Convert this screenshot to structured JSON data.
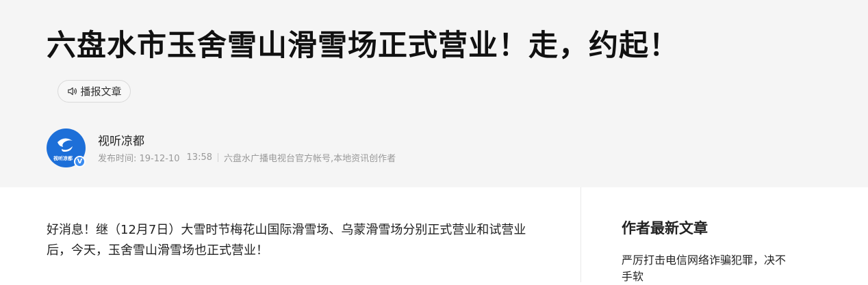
{
  "article": {
    "title": "六盘水市玉舍雪山滑雪场正式营业！走，约起！",
    "listen_label": "播报文章",
    "content": "好消息！继（12月7日）大雪时节梅花山国际滑雪场、乌蒙滑雪场分别正式营业和试营业后，今天，玉舍雪山滑雪场也正式营业！"
  },
  "author": {
    "name": "视听凉都",
    "avatar_text": "视听凉都",
    "verified_mark": "V",
    "publish_date": "发布时间: 19-12-10",
    "publish_time": "13:58",
    "description": "六盘水广播电视台官方帐号,本地资讯创作者"
  },
  "sidebar": {
    "heading": "作者最新文章",
    "articles": [
      {
        "title": "严厉打击电信网络诈骗犯罪，决不手软"
      }
    ]
  },
  "colors": {
    "header_bg": "#f5f5f5",
    "avatar_bg": "#1d6fd8",
    "verify_badge": "#3b8cf0"
  }
}
